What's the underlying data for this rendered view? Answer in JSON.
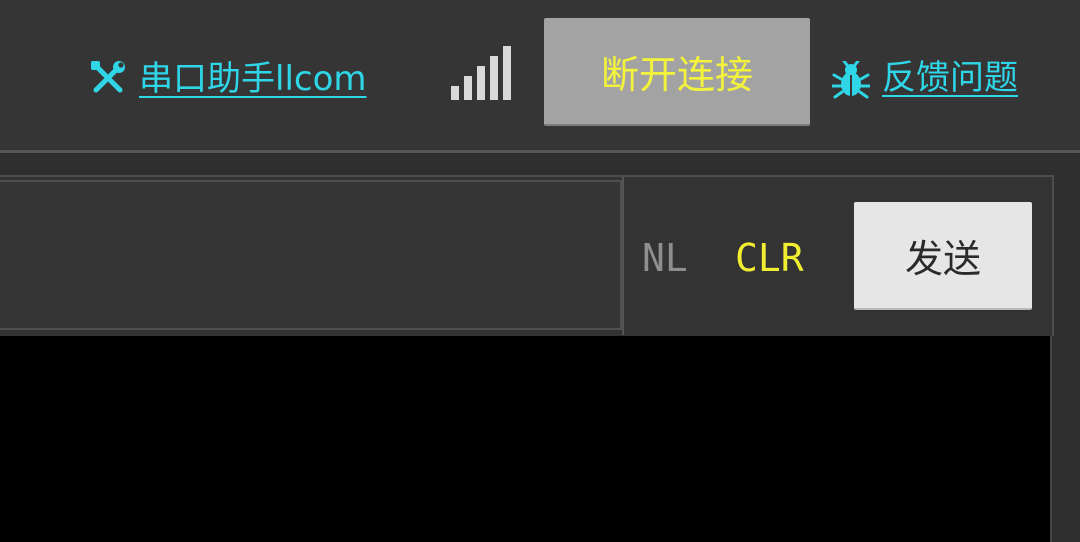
{
  "header": {
    "site_link": "串口助手llcom",
    "disconnect_label": "断开连接",
    "feedback_link": "反馈问题"
  },
  "send_bar": {
    "input_value": "",
    "input_placeholder": "",
    "nl_label": "NL",
    "clr_label": "CLR",
    "send_label": "发送"
  },
  "output": {
    "text": ""
  },
  "colors": {
    "link": "#2fd6e8",
    "accent_yellow": "#f4f33b",
    "background": "#2f2f2f",
    "output_bg": "#000000"
  },
  "icons": {
    "site": "wrench-screwdriver-icon",
    "signal": "signal-strength-icon",
    "feedback": "bug-icon"
  }
}
